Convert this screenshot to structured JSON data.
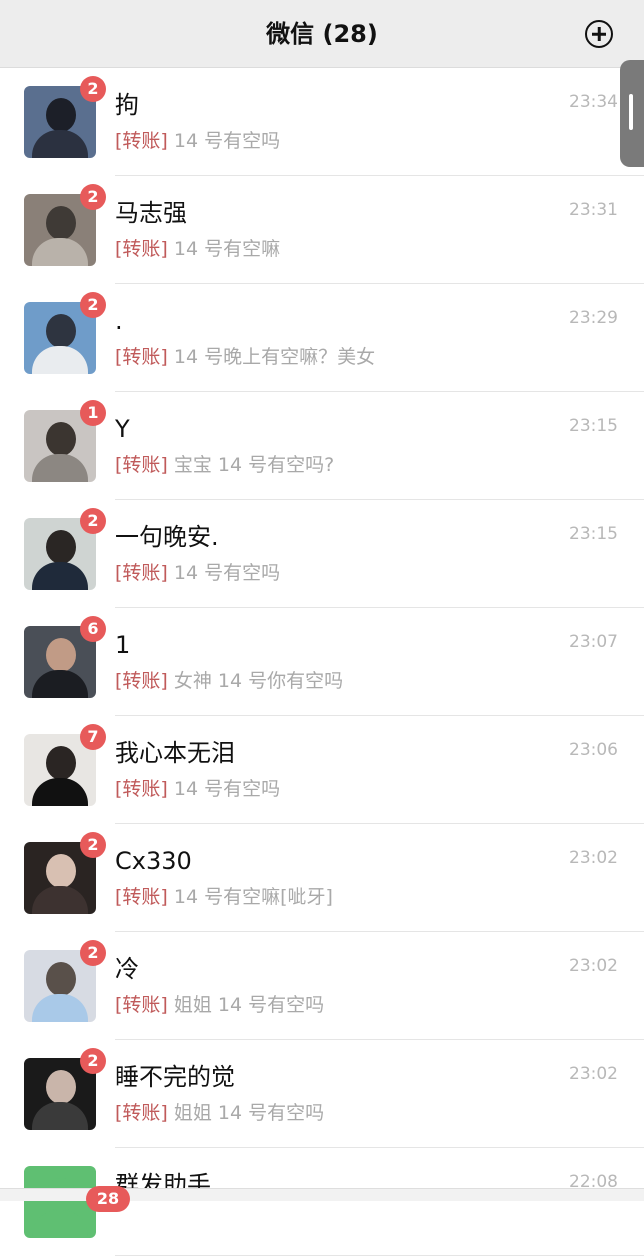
{
  "header": {
    "title": "微信 (28)"
  },
  "chats": [
    {
      "name": "拘",
      "time": "23:34",
      "badge": "2",
      "tag": "[转账]",
      "preview": "14 号有空吗",
      "colors": [
        "#5a6f8f",
        "#1c1f28",
        "#2b3140"
      ]
    },
    {
      "name": "马志强",
      "time": "23:31",
      "badge": "2",
      "tag": "[转账]",
      "preview": "14 号有空嘛",
      "colors": [
        "#8a8078",
        "#3f3a36",
        "#b9b2aa"
      ]
    },
    {
      "name": ".",
      "time": "23:29",
      "badge": "2",
      "tag": "[转账]",
      "preview": "14 号晚上有空嘛？美女",
      "colors": [
        "#6f9cc9",
        "#2e3440",
        "#e9ecef"
      ]
    },
    {
      "name": "Y",
      "time": "23:15",
      "badge": "1",
      "tag": "[转账]",
      "preview": "宝宝 14 号有空吗?",
      "colors": [
        "#c9c5c2",
        "#3b3530",
        "#8c8782"
      ]
    },
    {
      "name": "一句晚安.",
      "time": "23:15",
      "badge": "2",
      "tag": "[转账]",
      "preview": "14 号有空吗",
      "colors": [
        "#cfd4d2",
        "#2a2624",
        "#1f2a3a"
      ]
    },
    {
      "name": "1",
      "time": "23:07",
      "badge": "6",
      "tag": "[转账]",
      "preview": "女神 14 号你有空吗",
      "colors": [
        "#4a4f57",
        "#c19b86",
        "#1b1d22"
      ]
    },
    {
      "name": "我心本无泪",
      "time": "23:06",
      "badge": "7",
      "tag": "[转账]",
      "preview": "14 号有空吗",
      "colors": [
        "#e8e6e3",
        "#2a2523",
        "#111111"
      ]
    },
    {
      "name": "Cx330",
      "time": "23:02",
      "badge": "2",
      "tag": "[转账]",
      "preview": "14 号有空嘛[呲牙]",
      "colors": [
        "#2a2422",
        "#d8c0b2",
        "#3d3230"
      ]
    },
    {
      "name": "冷",
      "time": "23:02",
      "badge": "2",
      "tag": "[转账]",
      "preview": "姐姐 14 号有空吗",
      "colors": [
        "#d7dbe3",
        "#59504a",
        "#a9c9e8"
      ]
    },
    {
      "name": "睡不完的觉",
      "time": "23:02",
      "badge": "2",
      "tag": "[转账]",
      "preview": "姐姐 14 号有空吗",
      "colors": [
        "#1a1a1a",
        "#c9b5aa",
        "#3a3a3a"
      ]
    },
    {
      "name": "群发助手",
      "time": "22:08",
      "badge": "",
      "tag": "",
      "preview": "",
      "colors": [
        "#5fbf72",
        "#5fbf72",
        "#5fbf72"
      ]
    }
  ],
  "tabbar": {
    "badge": "28"
  }
}
